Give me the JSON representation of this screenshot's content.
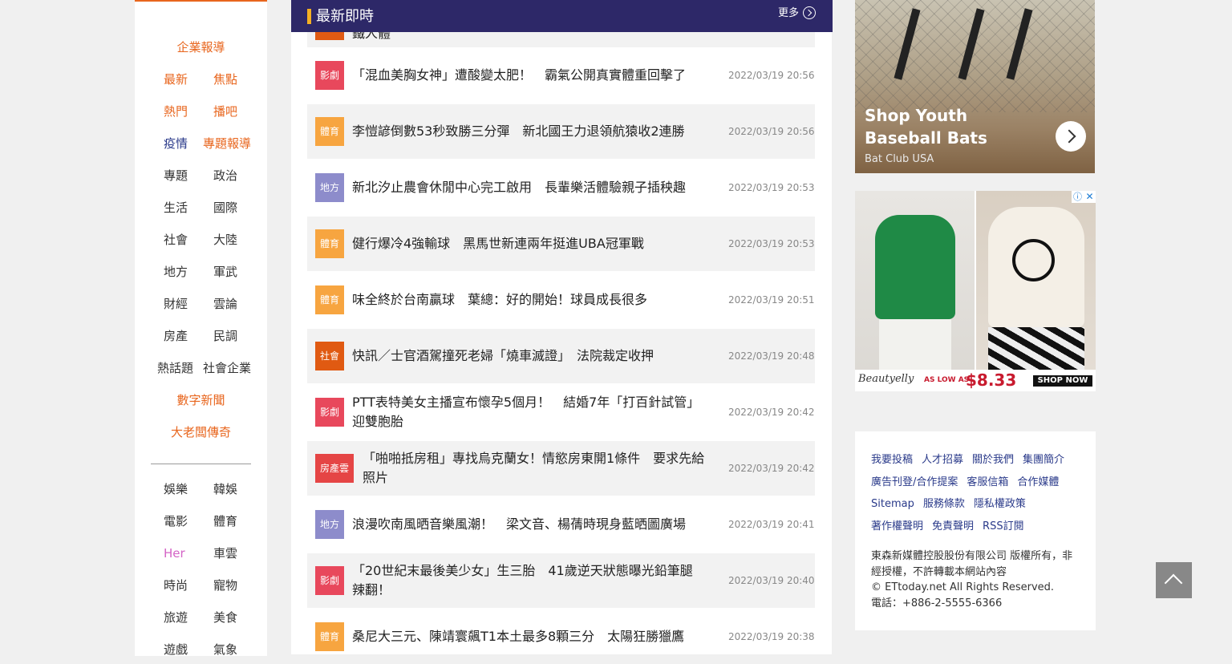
{
  "sidebar": {
    "cat_enterprise": "企業報導",
    "latest": "最新",
    "focus": "焦點",
    "hot": "熱門",
    "broadcast": "播吧",
    "pandemic": "疫情",
    "special_report": "專題報導",
    "topics": "專題",
    "politics": "政治",
    "life": "生活",
    "international": "國際",
    "society": "社會",
    "mainland": "大陸",
    "local": "地方",
    "military": "軍武",
    "finance": "財經",
    "cloud_opinion": "雲論",
    "real_estate": "房產",
    "poll": "民調",
    "hot_topics": "熱話題",
    "social_enterprise": "社會企業",
    "digital_news": "數字新聞",
    "boss_legend": "大老闆傳奇",
    "entertainment": "娛樂",
    "korean_ent": "韓娛",
    "movies": "電影",
    "sports": "體育",
    "her": "Her",
    "car_cloud": "車雲",
    "fashion": "時尚",
    "pets": "寵物",
    "travel": "旅遊",
    "food": "美食",
    "games": "遊戲",
    "weather": "氣象"
  },
  "header": {
    "title": "最新即時",
    "more": "更多"
  },
  "news_clip_text": "鐵人體",
  "news": [
    {
      "tag": "影劇",
      "title": "「混血美胸女神」遭酸變太肥！　霸氣公開真實體重回擊了",
      "time": "2022/03/19 20:56",
      "color": "#e8485c"
    },
    {
      "tag": "體育",
      "title": "李愷諺倒數53秒致勝三分彈　新北國王力退領航猿收2連勝",
      "time": "2022/03/19 20:56",
      "color": "#f7a540"
    },
    {
      "tag": "地方",
      "title": "新北汐止農會休閒中心完工啟用　長輩樂活體驗親子插秧趣",
      "time": "2022/03/19 20:53",
      "color": "#8d8ccb"
    },
    {
      "tag": "體育",
      "title": "健行爆冷4強輸球　黑馬世新連兩年挺進UBA冠軍戰",
      "time": "2022/03/19 20:53",
      "color": "#f7a540"
    },
    {
      "tag": "體育",
      "title": "味全終於台南贏球　葉總：好的開始！球員成長很多",
      "time": "2022/03/19 20:51",
      "color": "#f7a540"
    },
    {
      "tag": "社會",
      "title": "快訊／士官酒駕撞死老婦「燒車滅證」　法院裁定收押",
      "time": "2022/03/19 20:48",
      "color": "#e05a12"
    },
    {
      "tag": "影劇",
      "title": "PTT表特美女主播宣布懷孕5個月！　結婚7年「打百針試管」迎雙胞胎",
      "time": "2022/03/19 20:42",
      "color": "#e8485c"
    },
    {
      "tag": "房產雲",
      "title": "「啪啪抵房租」專找烏克蘭女！情慾房東開1條件　要求先給照片",
      "time": "2022/03/19 20:42",
      "color": "#e54545"
    },
    {
      "tag": "地方",
      "title": "浪漫吹南風晒音樂風潮！　梁文音、楊蒨時現身藍晒圖廣場",
      "time": "2022/03/19 20:41",
      "color": "#8d8ccb"
    },
    {
      "tag": "影劇",
      "title": "「20世紀末最後美少女」生三胎　41歲逆天狀態曝光鉛筆腿辣翻！",
      "time": "2022/03/19 20:40",
      "color": "#e8485c"
    },
    {
      "tag": "體育",
      "title": "桑尼大三元、陳靖寰飆T1本土最多8顆三分　太陽狂勝獵鷹",
      "time": "2022/03/19 20:38",
      "color": "#f7a540"
    }
  ],
  "ad1": {
    "title": "Shop Youth Baseball Bats",
    "advertiser": "Bat Club USA"
  },
  "ad2": {
    "brand": "Beautyelly",
    "as_low_as": "AS LOW AS",
    "price": "$8.33",
    "cta": "SHOP NOW",
    "info": "ⓘ",
    "close": "✕"
  },
  "footer": {
    "links_row1": [
      "我要投稿",
      "人才招募",
      "關於我們",
      "集團簡介"
    ],
    "links_row2": [
      "廣告刊登/合作提案",
      "客服信箱",
      "合作媒體"
    ],
    "links_row3": [
      "Sitemap",
      "服務條款",
      "隱私權政策"
    ],
    "links_row4": [
      "著作權聲明",
      "免責聲明",
      "RSS訂閱"
    ],
    "copyright1": "東森新媒體控股股份有限公司 版權所有，非經授權，不許轉載本網站內容",
    "copyright2": "© ETtoday.net All Rights Reserved.",
    "phone": "電話：+886-2-5555-6366"
  },
  "colors": {
    "header_bg": "#2d2868",
    "accent_orange": "#e8661e",
    "link_blue": "#2a3a8a"
  }
}
